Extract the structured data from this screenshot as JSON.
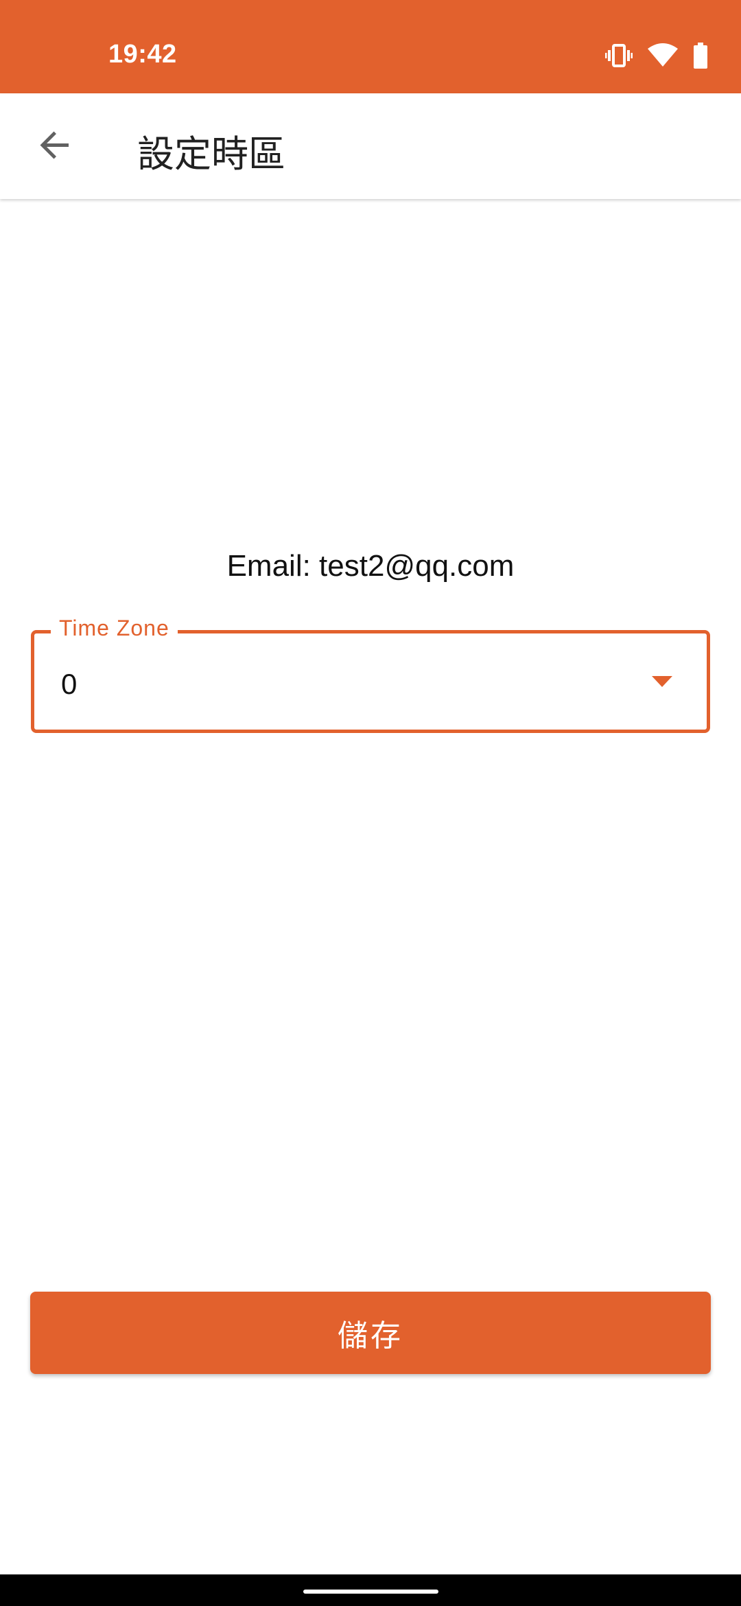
{
  "status_bar": {
    "time": "19:42",
    "icons": [
      "vibrate-icon",
      "wifi-icon",
      "battery-icon"
    ],
    "background": "#E2612D"
  },
  "app_bar": {
    "title": "設定時區",
    "back_icon": "arrow-back-icon"
  },
  "main": {
    "email_text": "Email: test2@qq.com",
    "time_zone": {
      "label": "Time Zone",
      "value": "0",
      "arrow_icon": "dropdown-arrow-icon"
    },
    "save_label": "儲存"
  },
  "colors": {
    "accent": "#E2612D",
    "text": "#111111",
    "background": "#ffffff"
  }
}
